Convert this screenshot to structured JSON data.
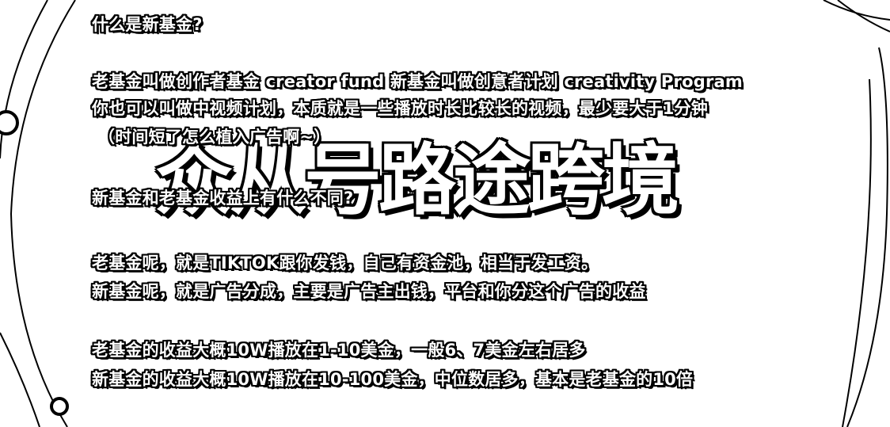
{
  "watermark": "众从号路途跨境",
  "lines": [
    "什么是新基金?",
    "老基金叫做创作者基金 creator fund   新基金叫做创意者计划 creativity Program",
    "你也可以叫做中视频计划，本质就是一些播放时长比较长的视频，最少要大于1分钟",
    "（时间短了怎么植入广告啊~）",
    "新基金和老基金收益上有什么不同?",
    "老基金呢，就是TIKTOK跟你发钱，自己有资金池，相当于发工资。",
    "新基金呢，就是广告分成，主要是广告主出钱，平台和你分这个广告的收益",
    "老基金的收益大概10W播放在1-10美金，一般6、7美金左右居多",
    "新基金的收益大概10W播放在10-100美金，中位数居多，基本是老基金的10倍"
  ]
}
